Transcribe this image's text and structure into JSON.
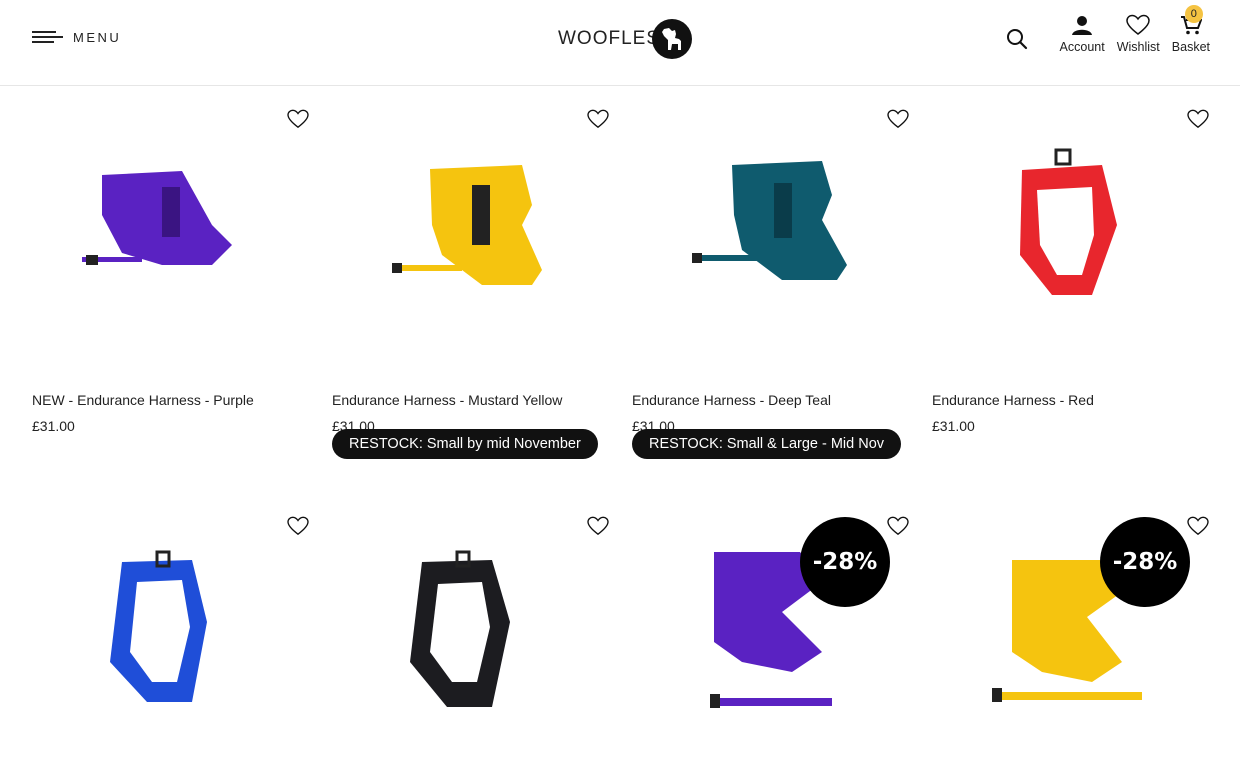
{
  "header": {
    "menu_label": "MENU",
    "logo_text": "WOOFLES",
    "account_label": "Account",
    "wishlist_label": "Wishlist",
    "basket_label": "Basket",
    "basket_count": "0"
  },
  "products": [
    {
      "name": "NEW - Endurance Harness - Purple",
      "price": "£31.00",
      "color": "#5a22c2"
    },
    {
      "name": "Endurance Harness - Mustard Yellow",
      "price": "£31.00",
      "color": "#f5c40f",
      "badge": "RESTOCK: Small by mid November"
    },
    {
      "name": "Endurance Harness - Deep Teal",
      "price": "£31.00",
      "color": "#0f5b6e",
      "badge": "RESTOCK: Small & Large - Mid Nov"
    },
    {
      "name": "Endurance Harness - Red",
      "price": "£31.00",
      "color": "#e8262d"
    },
    {
      "color": "#1f4ed8"
    },
    {
      "color": "#1c1c20"
    },
    {
      "color": "#5a22c2",
      "discount": "-28%"
    },
    {
      "color": "#f5c40f",
      "discount": "-28%"
    }
  ],
  "icons": {
    "menu": "hamburger-icon",
    "search": "search-icon",
    "account": "user-icon",
    "wishlist": "heart-icon",
    "basket": "basket-icon",
    "product_wishlist": "heart-outline-icon"
  }
}
